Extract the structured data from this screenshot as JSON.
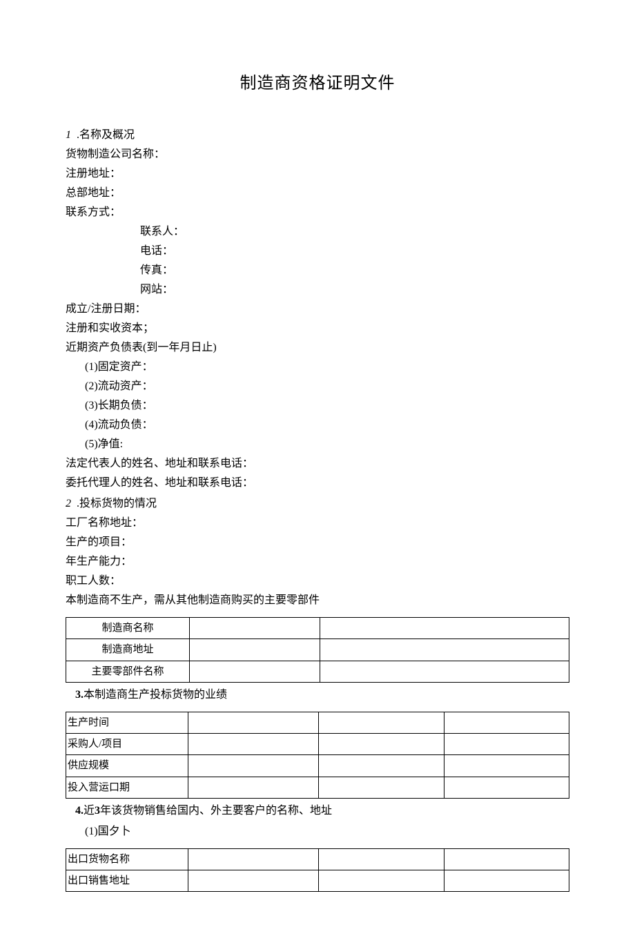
{
  "title": "制造商资格证明文件",
  "s1": {
    "num": "1",
    "dot": " .",
    "head": "名称及概况",
    "company": "货物制造公司名称：",
    "regaddr": "注册地址：",
    "hqaddr": "总部地址：",
    "contact": "联系方式：",
    "cperson": "联系人：",
    "cphone": "电话：",
    "cfax": "传真：",
    "cweb": "网站：",
    "estdate": "成立/注册日期：",
    "capital": "注册和实收资本；",
    "balance": "近期资产负债表(到一年月日止)",
    "b1": "(1)固定资产：",
    "b2": "(2)流动资产：",
    "b3": "(3)长期负债：",
    "b4": "(4)流动负债：",
    "b5": "(5)净值:",
    "legal": "法定代表人的姓名、地址和联系电话：",
    "agent": "委托代理人的姓名、地址和联系电话："
  },
  "s2": {
    "num": "2",
    "dot": " .",
    "head": "投标货物的情况",
    "factory": "工厂名称地址：",
    "proj": "生产的项目：",
    "capacity": "年生产能力：",
    "staff": "职工人数：",
    "outsource": "本制造商不生产，需从其他制造商购买的主要零部件",
    "t_r1": "制造商名称",
    "t_r2": "制造商地址",
    "t_r3": "主要零部件名称"
  },
  "s3": {
    "num": "3.",
    "head": "本制造商生产投标货物的业绩",
    "t_r1": "生产时间",
    "t_r2": "采购人/项目",
    "t_r3": "供应规模",
    "t_r4": "投入营运口期"
  },
  "s4": {
    "num": "4.",
    "head_a": "近",
    "head_n": "3",
    "head_b": "年该货物销售给国内、外主要客户的名称、地址",
    "sub": "(1)国夕卜",
    "t_r1": "出口货物名称",
    "t_r2": "出口销售地址"
  }
}
